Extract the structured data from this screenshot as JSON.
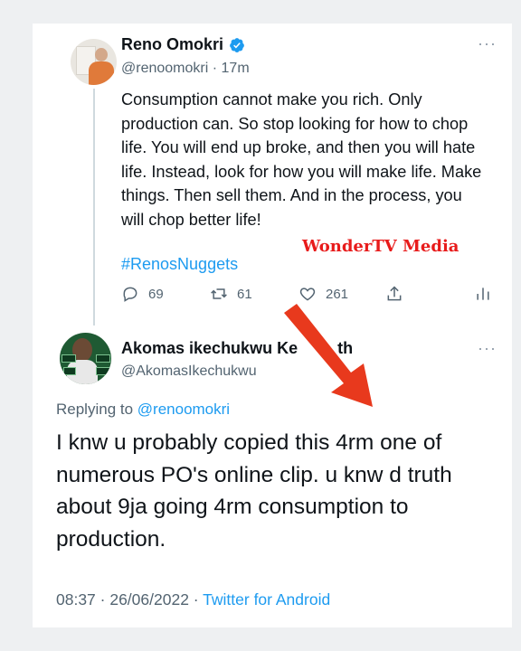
{
  "tweet": {
    "display_name": "Reno Omokri",
    "handle": "@renoomokri",
    "time": "17m",
    "more_label": "···",
    "text": "Consumption cannot make you rich. Only production can. So stop looking for how to chop life. You will end up broke, and then you will hate life. Instead, look for how you will make life. Make things. Then sell them. And in the process, you will chop better life!",
    "hashtag": "#RenosNuggets",
    "replies": "69",
    "retweets": "61",
    "likes": "261",
    "verified_color": "#1d9bf0"
  },
  "watermark": "WonderTV Media",
  "reply": {
    "display_name": "Akomas ikechukwu Ke",
    "display_name_tail": "th",
    "handle": "@AkomasIkechukwu",
    "more_label": "···",
    "replying_prefix": "Replying to ",
    "replying_to": "@renoomokri",
    "text": "I knw u probably copied this 4rm one of numerous PO's online clip. u knw d truth about 9ja going 4rm consumption to production.",
    "date_time": "08:37 · 26/06/2022 · ",
    "source": "Twitter for Android"
  },
  "colors": {
    "accent": "#1d9bf0",
    "arrow": "#e8391d",
    "watermark": "#e81b1b"
  },
  "icons": [
    "reply-icon",
    "retweet-icon",
    "like-icon",
    "share-icon",
    "analytics-icon",
    "verified-badge-icon"
  ]
}
